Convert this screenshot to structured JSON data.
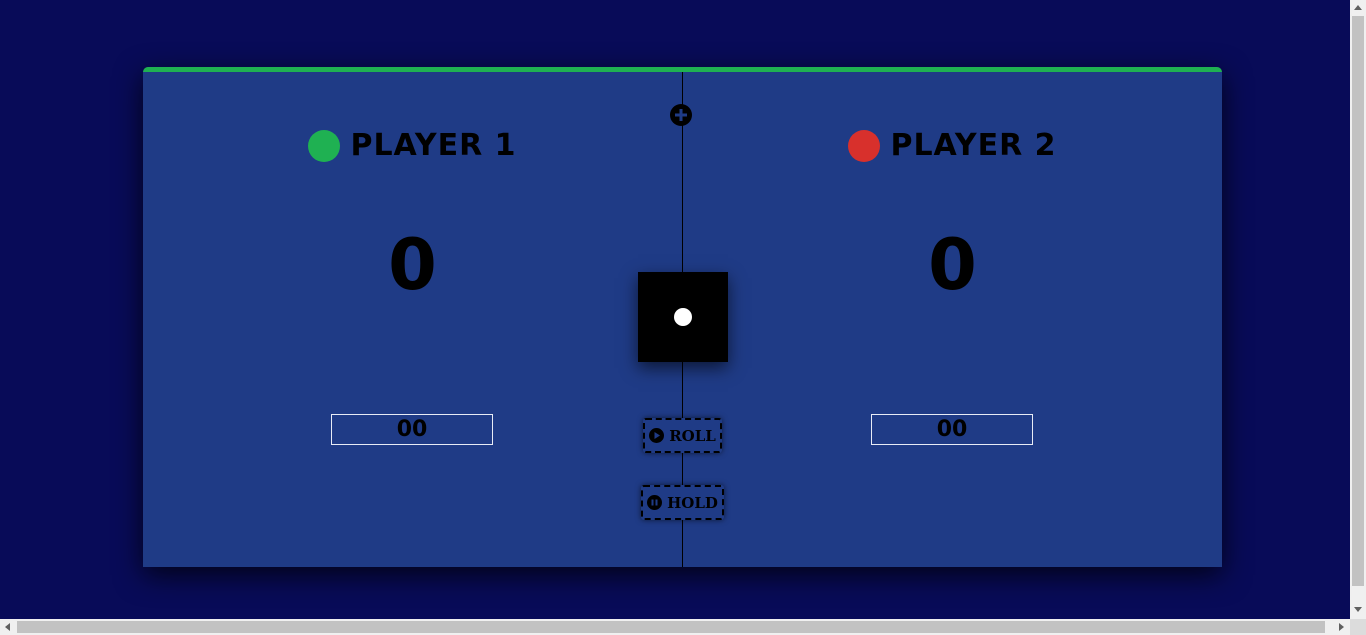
{
  "players": [
    {
      "name": "PLAYER 1",
      "score": "0",
      "current": "00",
      "color": "#1fb152",
      "active": true
    },
    {
      "name": "PLAYER 2",
      "score": "0",
      "current": "00",
      "color": "#d8302c",
      "active": false
    }
  ],
  "controls": {
    "roll_label": "ROLL",
    "hold_label": "HOLD",
    "new_game_icon": "plus-circle-icon",
    "roll_icon": "play-circle-icon",
    "hold_icon": "pause-circle-icon"
  },
  "dice": {
    "value": 1
  },
  "colors": {
    "page_background": "#080b58",
    "board_background": "#1f3b86",
    "active_indicator": "#1fb152"
  }
}
